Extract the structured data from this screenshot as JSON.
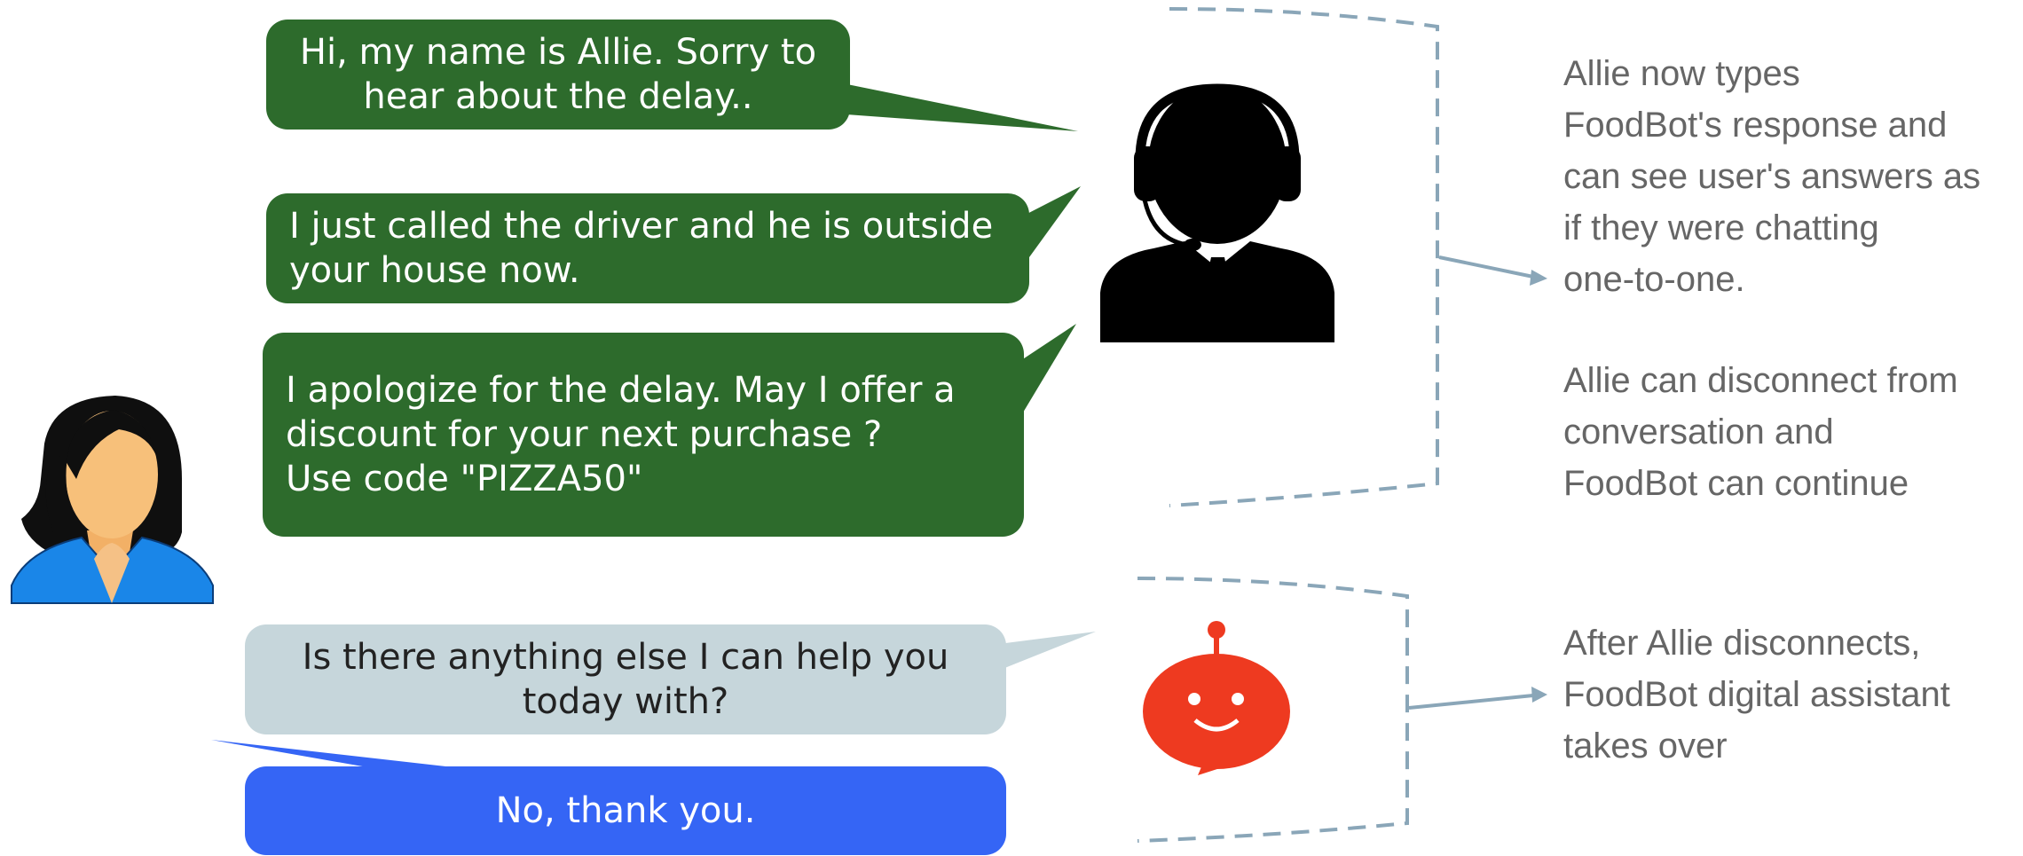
{
  "bubbles": [
    {
      "id": "b1",
      "lines": [
        "Hi, my name is Allie. Sorry to",
        "hear  about the delay.."
      ],
      "color": "#2d6b2c"
    },
    {
      "id": "b2",
      "lines": [
        "I just called the driver and he is outside",
        "your house now."
      ],
      "color": "#2d6b2c"
    },
    {
      "id": "b3",
      "lines": [
        "I apologize for the delay. May I offer a",
        "discount for your next purchase ?",
        "Use code \"PIZZA50\""
      ],
      "color": "#2d6b2c"
    },
    {
      "id": "b4",
      "lines": [
        "Is there anything else I can help you",
        "today with?"
      ],
      "color": "#c6d6db"
    },
    {
      "id": "b5",
      "lines": [
        "No, thank you."
      ],
      "color": "#3565f5"
    }
  ],
  "notes": {
    "agent": [
      "Allie now types",
      "FoodBot's response and",
      "can see user's answers as",
      "if they were chatting",
      "one-to-one."
    ],
    "disconnect": [
      "Allie can disconnect from",
      "conversation and",
      "FoodBot can continue"
    ],
    "bot": [
      "After Allie disconnects,",
      "FoodBot digital assistant",
      "takes over"
    ]
  },
  "icons": {
    "user": "woman-avatar-icon",
    "agent": "headset-agent-icon",
    "bot": "robot-chat-icon"
  },
  "colors": {
    "agent_bubble": "#2d6b2c",
    "bot_bubble": "#c6d6db",
    "user_bubble": "#3565f5",
    "bracket": "#8aa6b8",
    "robot": "#ee3a20"
  }
}
